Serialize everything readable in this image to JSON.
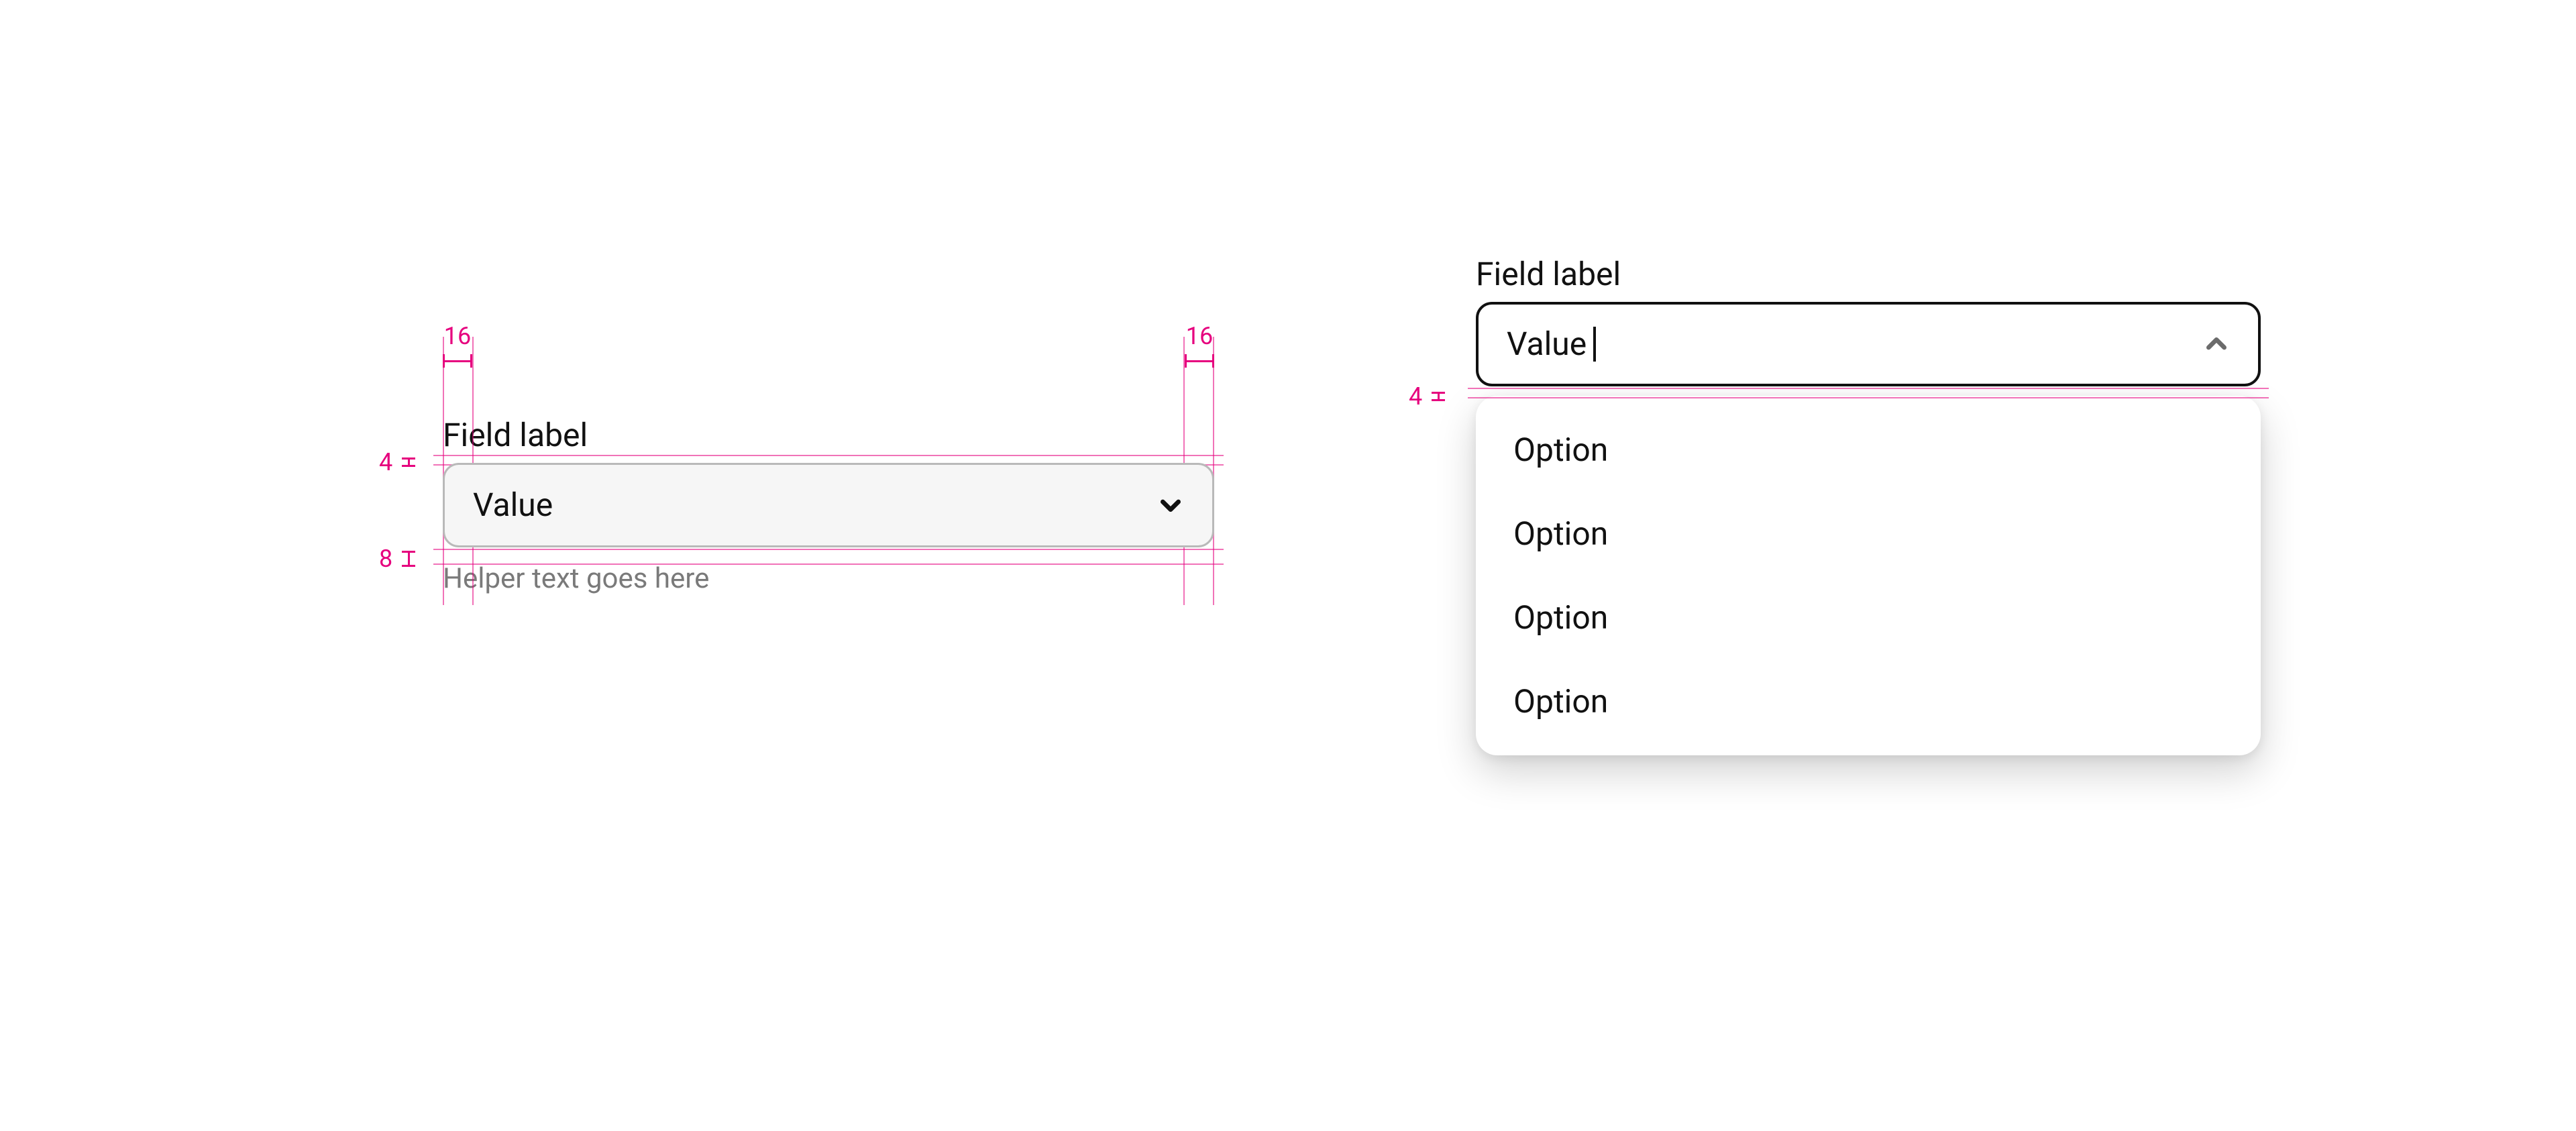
{
  "spec": {
    "pink_color": "#e6007e",
    "left": {
      "label": "Field label",
      "value": "Value",
      "helper": "Helper text goes here",
      "padding_left_px": "16",
      "padding_right_px": "16",
      "gap_label_to_field_px": "4",
      "gap_field_to_helper_px": "8"
    },
    "right": {
      "label": "Field label",
      "value": "Value",
      "gap_field_to_menu_px": "4",
      "options": [
        "Option",
        "Option",
        "Option",
        "Option"
      ]
    }
  }
}
